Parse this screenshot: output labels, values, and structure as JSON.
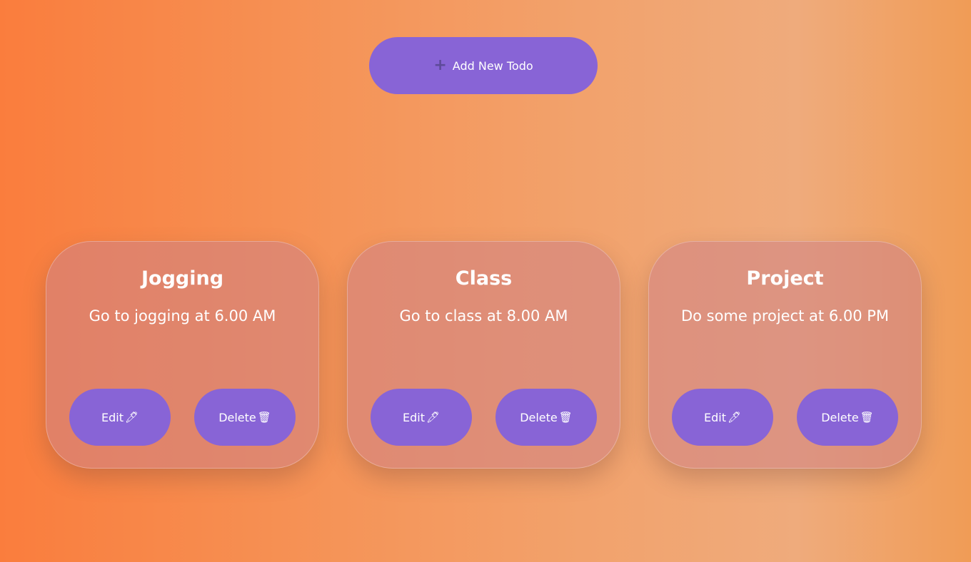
{
  "add_button": {
    "label": "Add New Todo",
    "icon": "+"
  },
  "todos": [
    {
      "title": "Jogging",
      "description": "Go to jogging at 6.00 AM",
      "edit_label": "Edit",
      "edit_icon": "🖊",
      "delete_label": "Delete",
      "delete_icon": "🗑"
    },
    {
      "title": "Class",
      "description": "Go to class at 8.00 AM",
      "edit_label": "Edit",
      "edit_icon": "🖊",
      "delete_label": "Delete",
      "delete_icon": "🗑"
    },
    {
      "title": "Project",
      "description": "Do some project at 6.00 PM",
      "edit_label": "Edit",
      "edit_icon": "🖊",
      "delete_label": "Delete",
      "delete_icon": "🗑"
    }
  ],
  "colors": {
    "button": "#8864d6",
    "card": "#cd8287",
    "background_left": "#fa7d3d",
    "background_right": "#efab7c"
  }
}
